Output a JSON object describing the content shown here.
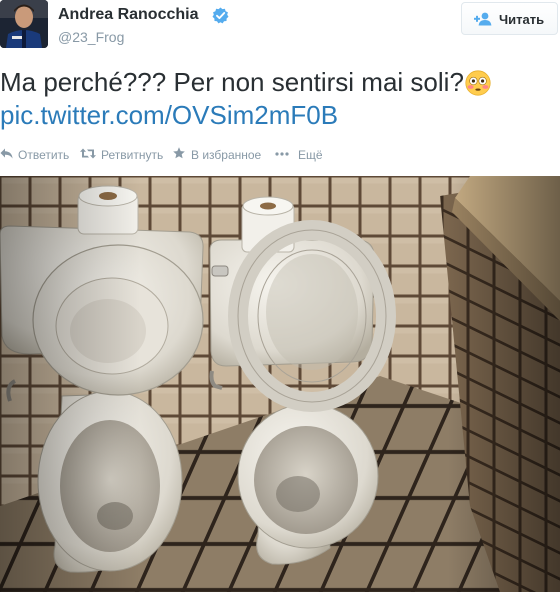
{
  "author": {
    "fullname": "Andrea Ranocchia",
    "username": "@23_Frog",
    "verified": true
  },
  "follow_button": {
    "label": "Читать",
    "icon": "add-user-icon"
  },
  "tweet": {
    "text": "Ma perché??? Per non sentirsi mai soli?",
    "emoji": "flushed-face-emoji",
    "link": "pic.twitter.com/OVSim2mF0B"
  },
  "actions": [
    {
      "label": "Ответить",
      "icon": "reply-icon"
    },
    {
      "label": "Ретвитнуть",
      "icon": "retweet-icon"
    },
    {
      "label": "В избранное",
      "icon": "star-icon"
    },
    {
      "label": "Ещё",
      "icon": "more-dots-icon"
    }
  ],
  "colors": {
    "link": "#2b7bb9",
    "muted": "#8899a6",
    "verified": "#55acee"
  }
}
